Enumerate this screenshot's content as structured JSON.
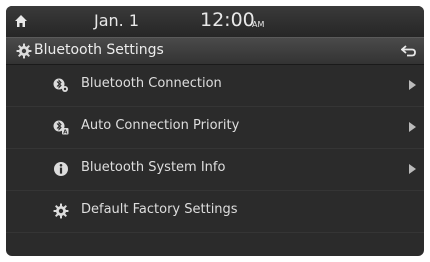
{
  "status_bar": {
    "date": "Jan.  1",
    "time": "12:00",
    "ampm": "AM",
    "home_icon": "home-icon"
  },
  "header": {
    "title": "Bluetooth Settings",
    "title_icon": "gear-icon",
    "back_icon": "back-arrow-icon"
  },
  "menu": {
    "items": [
      {
        "label": "Bluetooth Connection",
        "icon": "bluetooth-connection-icon",
        "has_arrow": true
      },
      {
        "label": "Auto Connection Priority",
        "icon": "auto-connection-icon",
        "has_arrow": true
      },
      {
        "label": "Bluetooth System Info",
        "icon": "info-icon",
        "has_arrow": true
      },
      {
        "label": "Default Factory Settings",
        "icon": "gear-icon",
        "has_arrow": false
      }
    ]
  },
  "colors": {
    "background": "#2b2b2b",
    "text": "#dedede",
    "titlebar": "#3d3d3d"
  }
}
